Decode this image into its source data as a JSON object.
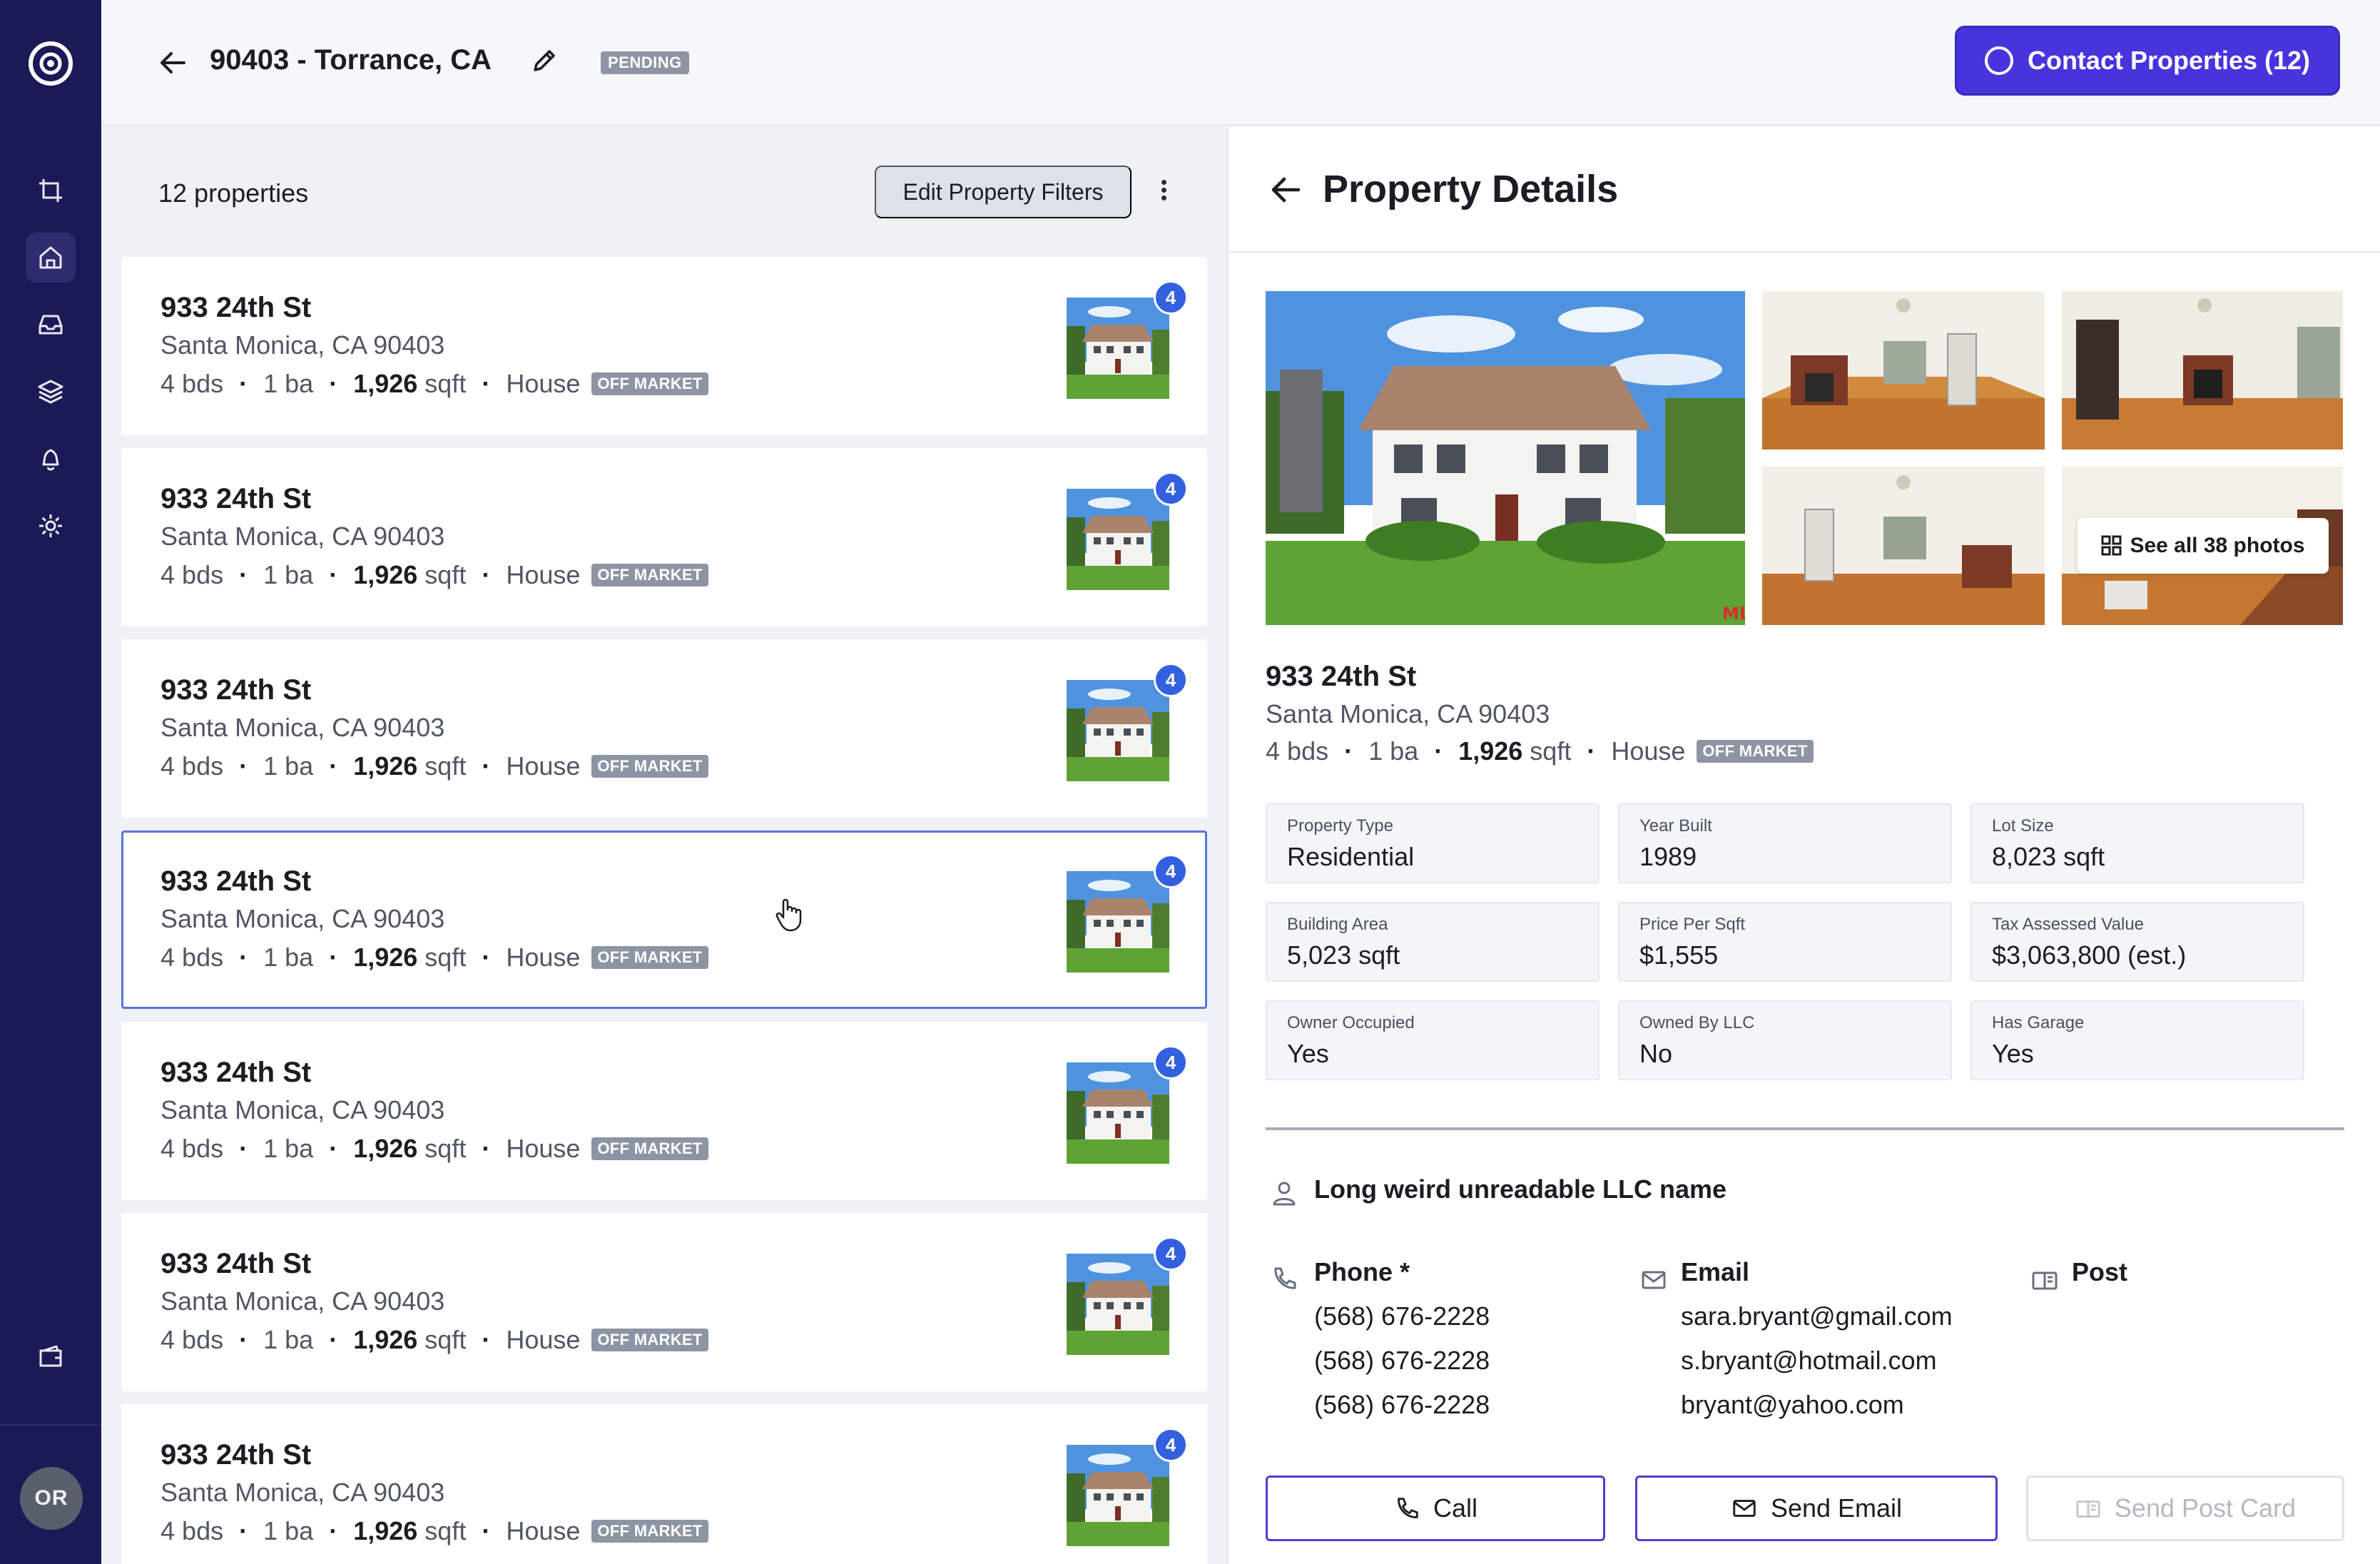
{
  "header": {
    "title": "90403 - Torrance, CA",
    "status_badge": "PENDING",
    "contact_button": "Contact Properties (12)"
  },
  "sidebar": {
    "items": [
      {
        "icon": "crop-icon"
      },
      {
        "icon": "home-icon",
        "active": true
      },
      {
        "icon": "inbox-icon"
      },
      {
        "icon": "layers-icon"
      },
      {
        "icon": "bell-icon"
      },
      {
        "icon": "gear-icon"
      },
      {
        "icon": "wallet-icon"
      }
    ],
    "avatar": "OR"
  },
  "list": {
    "count": "12 properties",
    "filter_button": "Edit Property Filters",
    "cards": [
      {
        "address": "933 24th St",
        "city": "Santa Monica, CA 90403",
        "beds": "4",
        "beds_unit": "bds",
        "baths": "1",
        "baths_unit": "ba",
        "sqft": "1,926",
        "sqft_unit": "sqft",
        "type": "House",
        "badge": "OFF MARKET",
        "photo_count": "4"
      },
      {
        "address": "933 24th St",
        "city": "Santa Monica, CA 90403",
        "beds": "4",
        "beds_unit": "bds",
        "baths": "1",
        "baths_unit": "ba",
        "sqft": "1,926",
        "sqft_unit": "sqft",
        "type": "House",
        "badge": "OFF MARKET",
        "photo_count": "4"
      },
      {
        "address": "933 24th St",
        "city": "Santa Monica, CA 90403",
        "beds": "4",
        "beds_unit": "bds",
        "baths": "1",
        "baths_unit": "ba",
        "sqft": "1,926",
        "sqft_unit": "sqft",
        "type": "House",
        "badge": "OFF MARKET",
        "photo_count": "4"
      },
      {
        "address": "933 24th St",
        "city": "Santa Monica, CA 90403",
        "beds": "4",
        "beds_unit": "bds",
        "baths": "1",
        "baths_unit": "ba",
        "sqft": "1,926",
        "sqft_unit": "sqft",
        "type": "House",
        "badge": "OFF MARKET",
        "photo_count": "4"
      },
      {
        "address": "933 24th St",
        "city": "Santa Monica, CA 90403",
        "beds": "4",
        "beds_unit": "bds",
        "baths": "1",
        "baths_unit": "ba",
        "sqft": "1,926",
        "sqft_unit": "sqft",
        "type": "House",
        "badge": "OFF MARKET",
        "photo_count": "4"
      },
      {
        "address": "933 24th St",
        "city": "Santa Monica, CA 90403",
        "beds": "4",
        "beds_unit": "bds",
        "baths": "1",
        "baths_unit": "ba",
        "sqft": "1,926",
        "sqft_unit": "sqft",
        "type": "House",
        "badge": "OFF MARKET",
        "photo_count": "4"
      },
      {
        "address": "933 24th St",
        "city": "Santa Monica, CA 90403",
        "beds": "4",
        "beds_unit": "bds",
        "baths": "1",
        "baths_unit": "ba",
        "sqft": "1,926",
        "sqft_unit": "sqft",
        "type": "House",
        "badge": "OFF MARKET",
        "photo_count": "4"
      }
    ],
    "selected_index": 3
  },
  "details": {
    "title": "Property Details",
    "see_all_photos": "See all 38 photos",
    "address": "933 24th St",
    "city": "Santa Monica, CA 90403",
    "beds": "4",
    "beds_unit": "bds",
    "baths": "1",
    "baths_unit": "ba",
    "sqft": "1,926",
    "sqft_unit": "sqft",
    "type": "House",
    "badge": "OFF MARKET",
    "facts": [
      {
        "label": "Property Type",
        "value": "Residential"
      },
      {
        "label": "Year Built",
        "value": "1989"
      },
      {
        "label": "Lot Size",
        "value": "8,023 sqft"
      },
      {
        "label": "Building Area",
        "value": "5,023 sqft"
      },
      {
        "label": "Price Per Sqft",
        "value": "$1,555"
      },
      {
        "label": "Tax Assessed Value",
        "value": "$3,063,800 (est.)"
      },
      {
        "label": "Owner Occupied",
        "value": "Yes"
      },
      {
        "label": "Owned By LLC",
        "value": "No"
      },
      {
        "label": "Has Garage",
        "value": "Yes"
      }
    ],
    "owner": "Long weird unreadable LLC name",
    "phone": {
      "label": "Phone *",
      "values": [
        "(568) 676-2228",
        "(568) 676-2228",
        "(568) 676-2228"
      ]
    },
    "email": {
      "label": "Email",
      "values": [
        "sara.bryant@gmail.com",
        "s.bryant@hotmail.com",
        "bryant@yahoo.com"
      ]
    },
    "post": {
      "label": "Post"
    },
    "buttons": {
      "call": "Call",
      "send_email": "Send Email",
      "send_post_card": "Send Post Card"
    }
  },
  "colors": {
    "sidebar": "#1c1a56",
    "accent": "#4734dd",
    "badge_blue": "#3360e0",
    "badge_gray": "#8d94a3"
  }
}
